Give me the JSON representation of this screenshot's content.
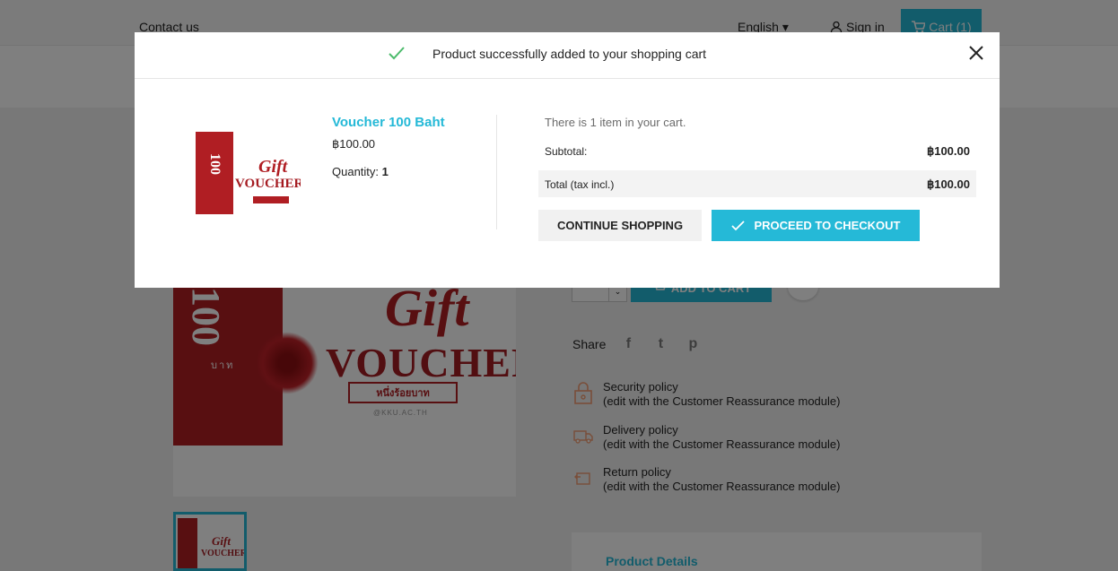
{
  "colors": {
    "accent": "#25b9d7",
    "brand_red": "#b01e23",
    "success_check": "#4cbb6c"
  },
  "topnav": {
    "contact": "Contact us",
    "language": "English",
    "signin": "Sign in",
    "cart": "Cart (1)"
  },
  "background": {
    "gift_word": "Gift",
    "voucher_word": "VOUCHER",
    "main_value": "100",
    "baht_word": "บาท",
    "thai_amount": "หนึ่งร้อยบาท",
    "kku_handle": "@KKU.AC.TH",
    "add_to_cart": "ADD TO CART",
    "share_label": "Share",
    "share_icons": [
      "facebook-icon",
      "twitter-icon",
      "pinterest-icon"
    ],
    "reassurance": [
      {
        "title": "Security policy",
        "desc": "(edit with the Customer Reassurance module)",
        "icon": "lock-icon"
      },
      {
        "title": "Delivery policy",
        "desc": "(edit with the Customer Reassurance module)",
        "icon": "truck-icon"
      },
      {
        "title": "Return policy",
        "desc": "(edit with the Customer Reassurance module)",
        "icon": "return-icon"
      }
    ],
    "details_tab": "Product Details"
  },
  "modal": {
    "message": "Product successfully added to your shopping cart",
    "product": {
      "name": "Voucher 100 Baht",
      "price": "฿100.00",
      "quantity_label": "Quantity:",
      "quantity_value": "1"
    },
    "cart_summary": {
      "count_text": "There is 1 item in your cart.",
      "subtotal_label": "Subtotal:",
      "subtotal_value": "฿100.00",
      "total_label": "Total (tax incl.)",
      "total_value": "฿100.00"
    },
    "continue_label": "CONTINUE SHOPPING",
    "checkout_label": "PROCEED TO CHECKOUT"
  }
}
